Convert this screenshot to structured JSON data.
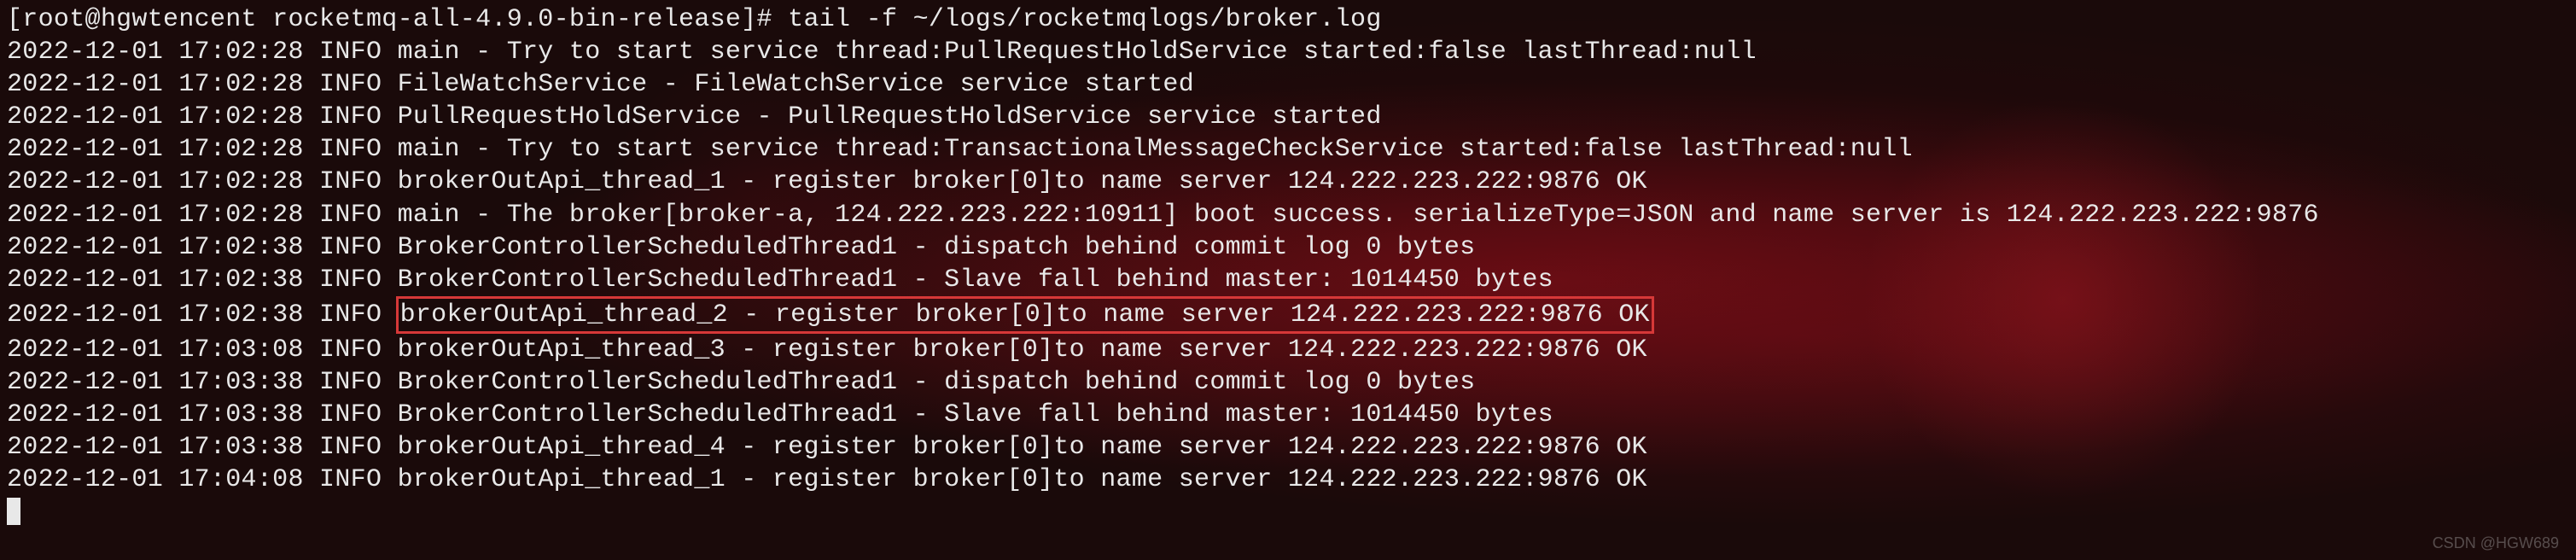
{
  "terminal": {
    "prompt": "[root@hgwtencent rocketmq-all-4.9.0-bin-release]# tail -f ~/logs/rocketmqlogs/broker.log",
    "lines": [
      "2022-12-01 17:02:28 INFO main - Try to start service thread:PullRequestHoldService started:false lastThread:null",
      "2022-12-01 17:02:28 INFO FileWatchService - FileWatchService service started",
      "2022-12-01 17:02:28 INFO PullRequestHoldService - PullRequestHoldService service started",
      "2022-12-01 17:02:28 INFO main - Try to start service thread:TransactionalMessageCheckService started:false lastThread:null",
      "2022-12-01 17:02:28 INFO brokerOutApi_thread_1 - register broker[0]to name server 124.222.223.222:9876 OK",
      "2022-12-01 17:02:28 INFO main - The broker[broker-a, 124.222.223.222:10911] boot success. serializeType=JSON and name server is 124.222.223.222:9876",
      "2022-12-01 17:02:38 INFO BrokerControllerScheduledThread1 - dispatch behind commit log 0 bytes",
      "2022-12-01 17:02:38 INFO BrokerControllerScheduledThread1 - Slave fall behind master: 1014450 bytes"
    ],
    "highlighted_prefix": "2022-12-01 17:02:38 INFO ",
    "highlighted_content": "brokerOutApi_thread_2 - register broker[0]to name server 124.222.223.222:9876 OK",
    "lines_after": [
      "2022-12-01 17:03:08 INFO brokerOutApi_thread_3 - register broker[0]to name server 124.222.223.222:9876 OK",
      "2022-12-01 17:03:38 INFO BrokerControllerScheduledThread1 - dispatch behind commit log 0 bytes",
      "2022-12-01 17:03:38 INFO BrokerControllerScheduledThread1 - Slave fall behind master: 1014450 bytes",
      "2022-12-01 17:03:38 INFO brokerOutApi_thread_4 - register broker[0]to name server 124.222.223.222:9876 OK",
      "2022-12-01 17:04:08 INFO brokerOutApi_thread_1 - register broker[0]to name server 124.222.223.222:9876 OK"
    ]
  },
  "watermark": "CSDN @HGW689"
}
